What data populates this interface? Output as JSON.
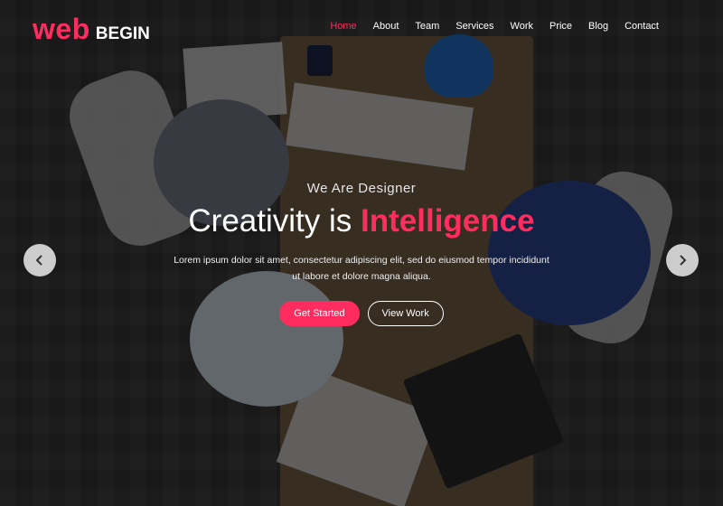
{
  "brand": {
    "primary": "web",
    "secondary": "BEGIN",
    "accent_color": "#ff2d5f"
  },
  "nav": {
    "items": [
      "Home",
      "About",
      "Team",
      "Services",
      "Work",
      "Price",
      "Blog",
      "Contact"
    ],
    "active": "Home"
  },
  "hero": {
    "subtitle": "We Are Designer",
    "title_prefix": "Creativity is",
    "title_highlight": "Intelligence",
    "description_line1": "Lorem ipsum dolor sit amet, consectetur adipiscing elit, sed do eiusmod tempor incididunt",
    "description_line2": "ut labore et dolore magna aliqua.",
    "primary_button": "Get Started",
    "secondary_button": "View Work"
  },
  "slider": {
    "prev_icon": "chevron-left-icon",
    "next_icon": "chevron-right-icon"
  }
}
